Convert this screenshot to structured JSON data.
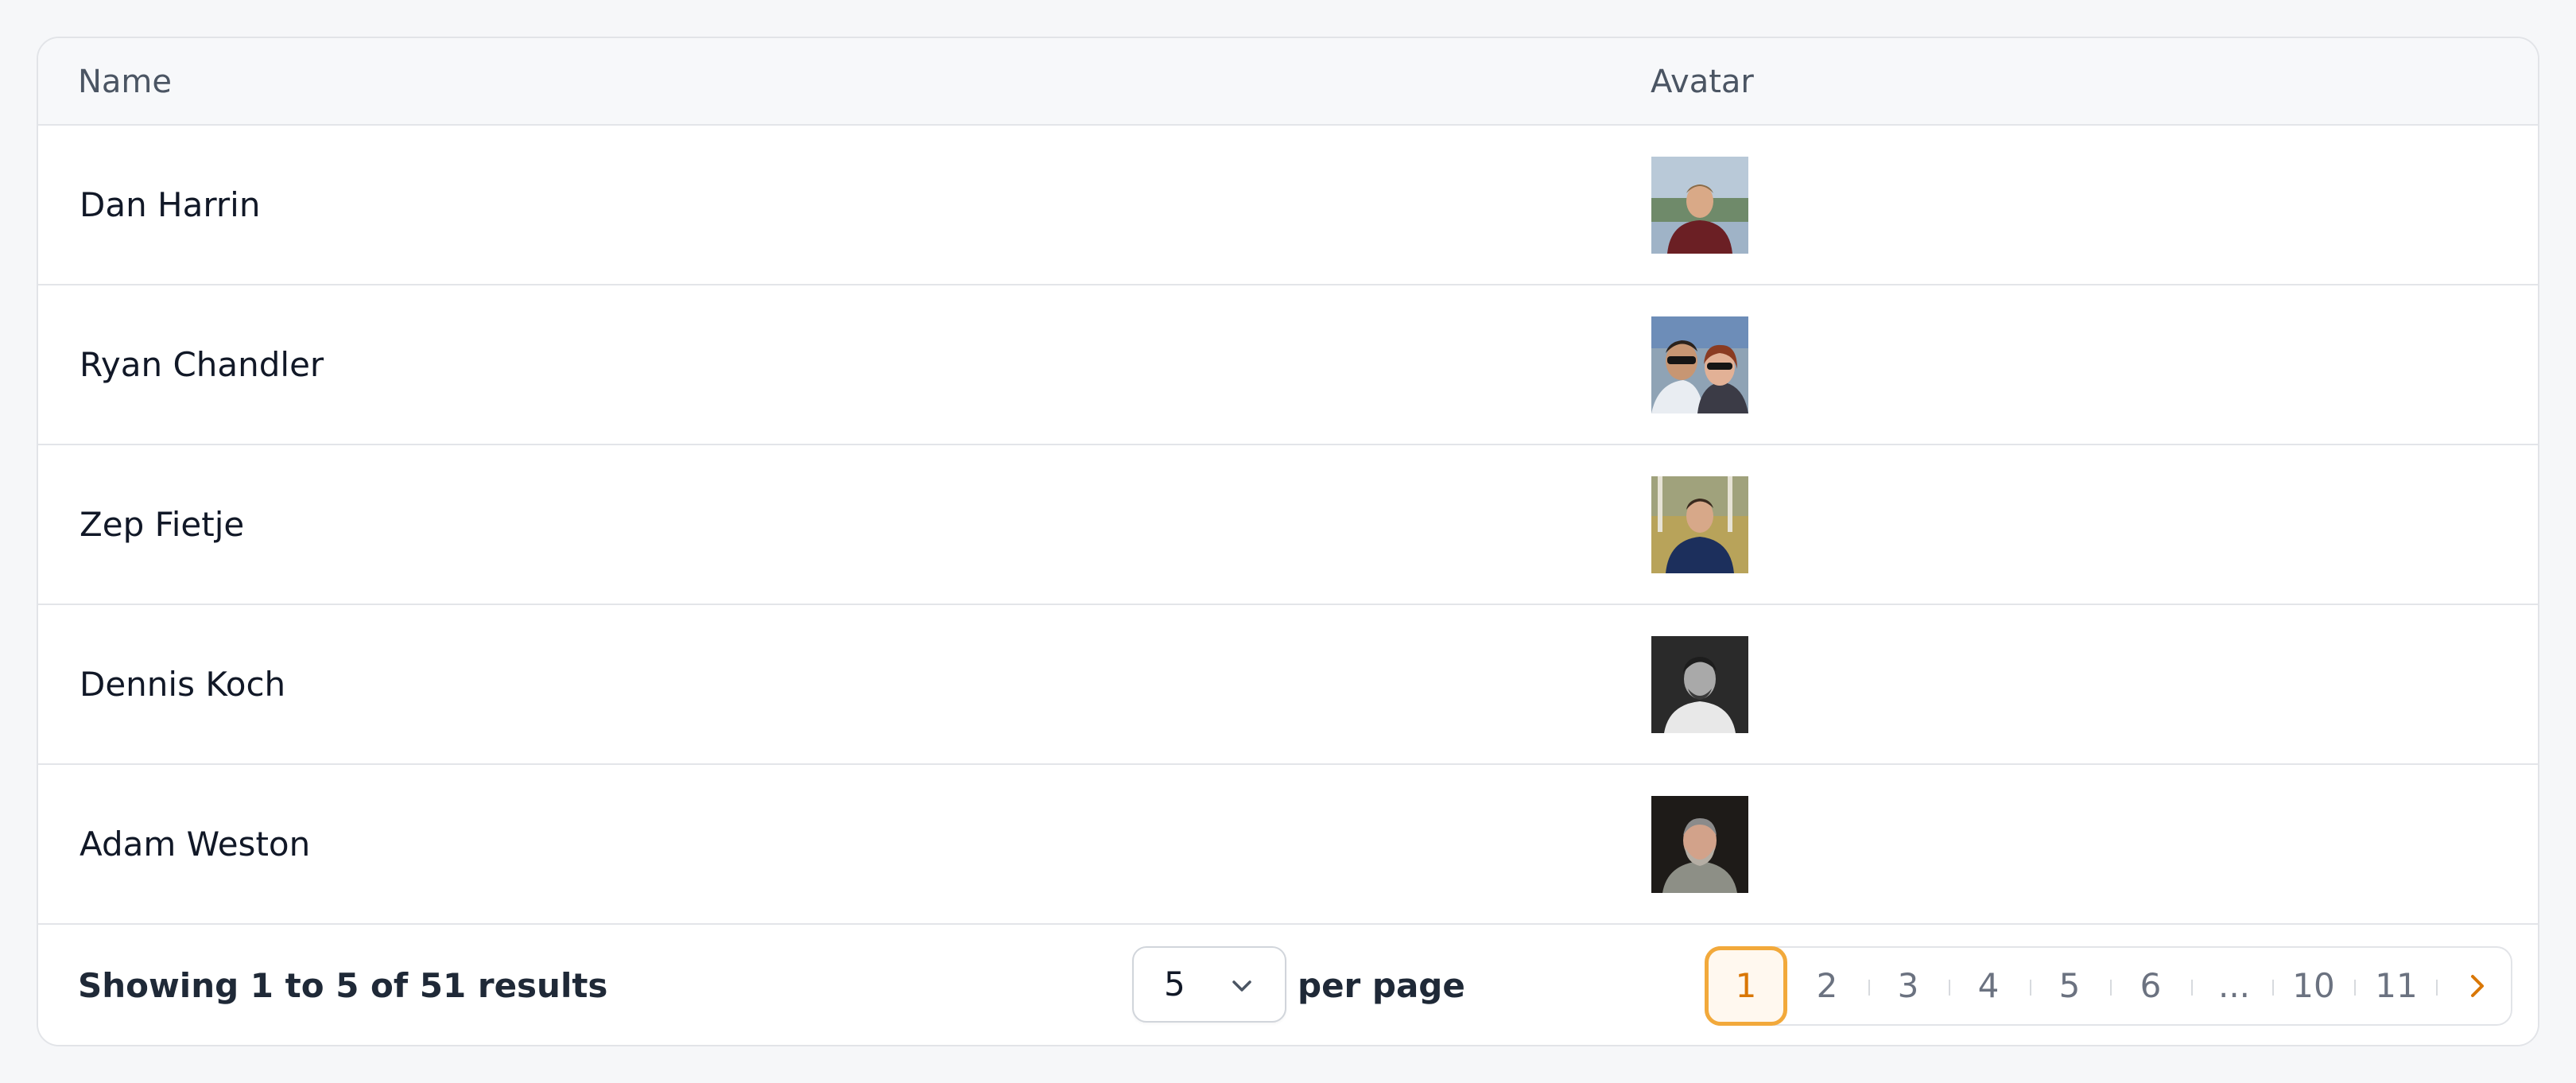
{
  "table": {
    "columns": {
      "name": "Name",
      "avatar": "Avatar"
    },
    "rows": [
      {
        "name": "Dan Harrin"
      },
      {
        "name": "Ryan Chandler"
      },
      {
        "name": "Zep Fietje"
      },
      {
        "name": "Dennis Koch"
      },
      {
        "name": "Adam Weston"
      }
    ]
  },
  "footer": {
    "showing": "Showing 1 to 5 of 51 results",
    "per_page_value": "5",
    "per_page_label": "per page"
  },
  "pagination": {
    "pages": [
      "1",
      "2",
      "3",
      "4",
      "5",
      "6",
      "...",
      "10",
      "11"
    ],
    "current": "1"
  },
  "colors": {
    "accent": "#f2a93b",
    "accent_text": "#d97706",
    "border": "#e2e4e8",
    "header_bg": "#f7f8fa"
  }
}
